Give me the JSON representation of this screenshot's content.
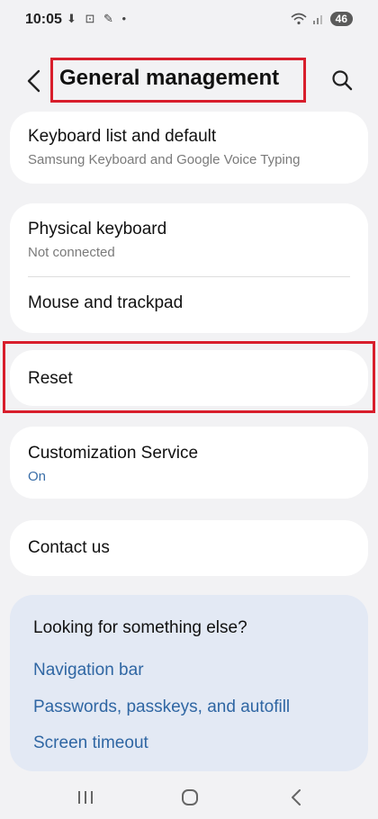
{
  "status_bar": {
    "time": "10:05",
    "icons": "⬇ ⊡ ✎ •",
    "battery": "46"
  },
  "header": {
    "title": "General management"
  },
  "sections": {
    "keyboard": {
      "title": "Keyboard list and default",
      "subtitle": "Samsung Keyboard and Google Voice Typing"
    },
    "physical": {
      "title": "Physical keyboard",
      "subtitle": "Not connected"
    },
    "mouse": {
      "title": "Mouse and trackpad"
    },
    "reset": {
      "title": "Reset"
    },
    "customization": {
      "title": "Customization Service",
      "subtitle": "On"
    },
    "contact": {
      "title": "Contact us"
    }
  },
  "suggestions": {
    "title": "Looking for something else?",
    "links": [
      "Navigation bar",
      "Passwords, passkeys, and autofill",
      "Screen timeout"
    ]
  },
  "colors": {
    "accent_red": "#d81e2c",
    "link_blue": "#2f66a3",
    "status_blue": "#3a6ea8"
  }
}
